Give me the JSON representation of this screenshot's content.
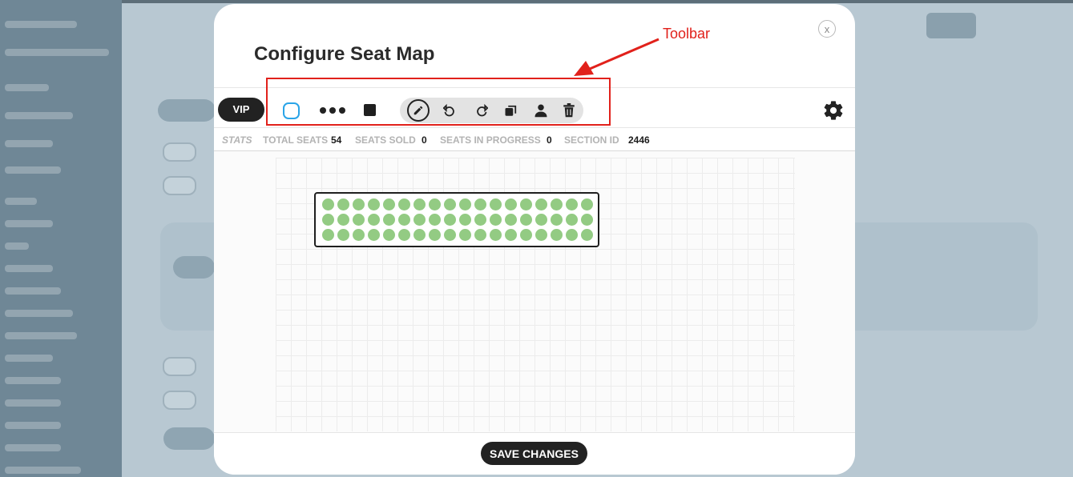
{
  "modal": {
    "title": "Configure Seat Map",
    "close_label": "x"
  },
  "toolbar": {
    "section_badge": "VIP",
    "tools": [
      "circle-select-icon",
      "dots-row-icon",
      "square-seat-icon",
      "pencil-icon",
      "undo-icon",
      "redo-icon",
      "copy-icon",
      "person-icon",
      "trash-icon"
    ],
    "settings_icon": "gear-icon"
  },
  "annotation": {
    "label": "Toolbar",
    "color": "#e1211b"
  },
  "stats": {
    "stats_label": "STATS",
    "total_seats_label": "TOTAL SEATS",
    "total_seats": "54",
    "seats_sold_label": "SEATS SOLD",
    "seats_sold": "0",
    "seats_in_progress_label": "SEATS IN PROGRESS",
    "seats_in_progress": "0",
    "section_id_label": "SECTION ID",
    "section_id": "2446"
  },
  "seat_map": {
    "rows": 3,
    "seats_per_row": 18,
    "seat_color": "#93cb83"
  },
  "footer": {
    "save_label": "SAVE CHANGES"
  }
}
